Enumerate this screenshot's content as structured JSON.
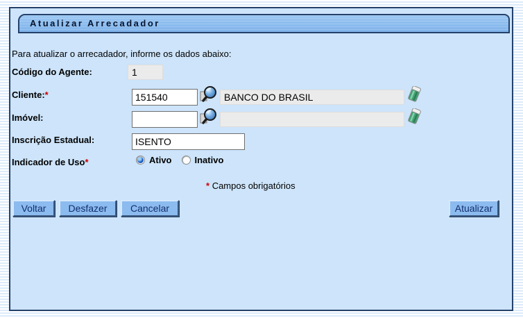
{
  "header": {
    "title": "Atualizar Arrecadador"
  },
  "form": {
    "instruction": "Para atualizar o arrecadador, informe os dados abaixo:",
    "required_marker": "*",
    "required_note": "Campos obrigatórios",
    "fields": {
      "codigo_agente": {
        "label": "Código do Agente:",
        "value": "1"
      },
      "cliente": {
        "label": "Cliente:",
        "required": "*",
        "code": "151540",
        "name": "BANCO DO BRASIL"
      },
      "imovel": {
        "label": "Imóvel:",
        "code": "",
        "name": ""
      },
      "inscricao_estadual": {
        "label": "Inscrição Estadual:",
        "value": "ISENTO"
      },
      "indicador_uso": {
        "label": "Indicador de Uso",
        "required": "*",
        "options": [
          {
            "label": "Ativo",
            "selected": true
          },
          {
            "label": "Inativo",
            "selected": false
          }
        ]
      }
    }
  },
  "buttons": {
    "voltar": "Voltar",
    "desfazer": "Desfazer",
    "cancelar": "Cancelar",
    "atualizar": "Atualizar"
  },
  "icons": {
    "search": "magnifier-search-icon",
    "erase": "eraser-clear-icon"
  },
  "colors": {
    "panel_background": "#cde4fa",
    "panel_border": "#24416b",
    "titlebar_fill": "#8fbfef",
    "button_fill": "#8cbbef",
    "button_text": "#122f6e",
    "required_red": "#cc0000",
    "readonly_field": "#ebebeb",
    "stripe_blue": "#dcebfa"
  }
}
